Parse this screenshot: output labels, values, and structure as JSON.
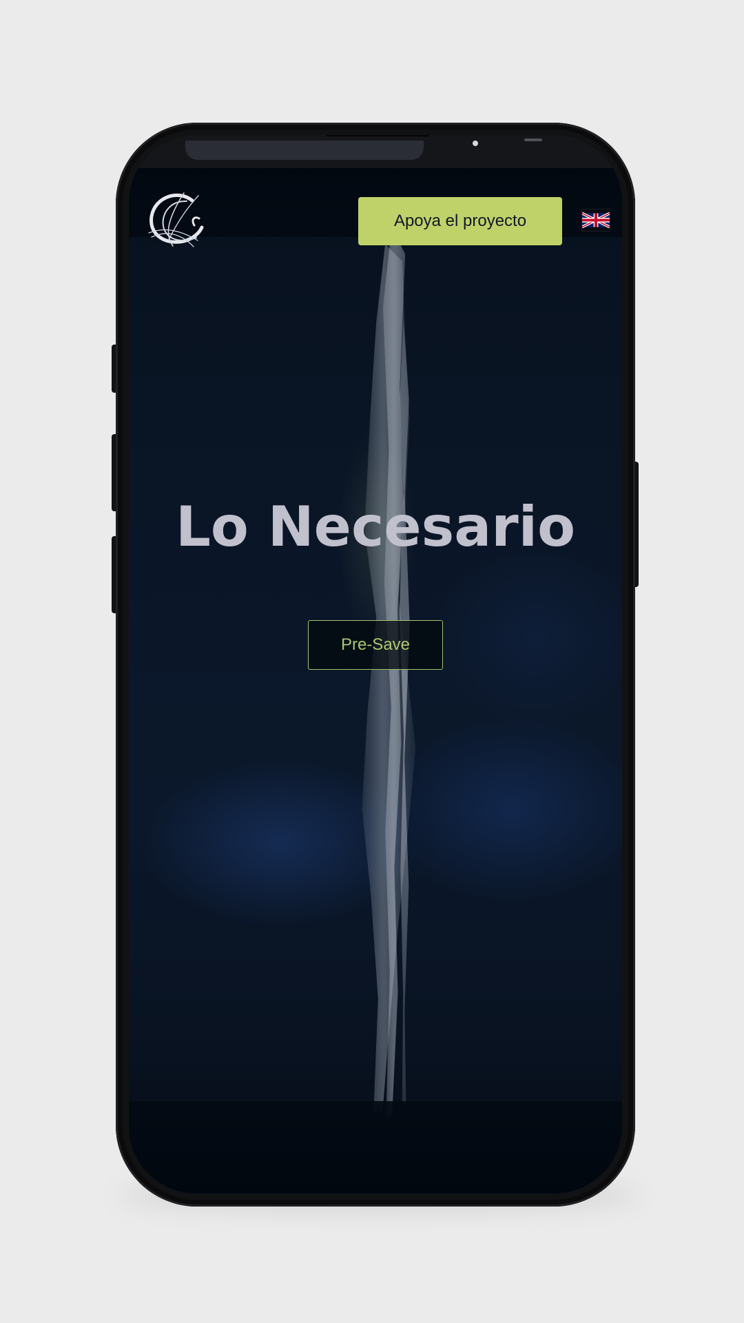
{
  "header": {
    "support_button": "Apoya el proyecto",
    "language_flag": "uk-flag-icon"
  },
  "hero": {
    "title": "Lo Necesario",
    "presave_button": "Pre-Save"
  },
  "colors": {
    "page_background": "#ebebec",
    "device_body": "#111213",
    "site_background": "#07101d",
    "accent_green": "#bfd26a",
    "title_text": "#c1c0cd",
    "presave_text": "#a9c86f"
  },
  "icons": {
    "logo": "logo-icon",
    "flag": "uk-flag-icon"
  }
}
